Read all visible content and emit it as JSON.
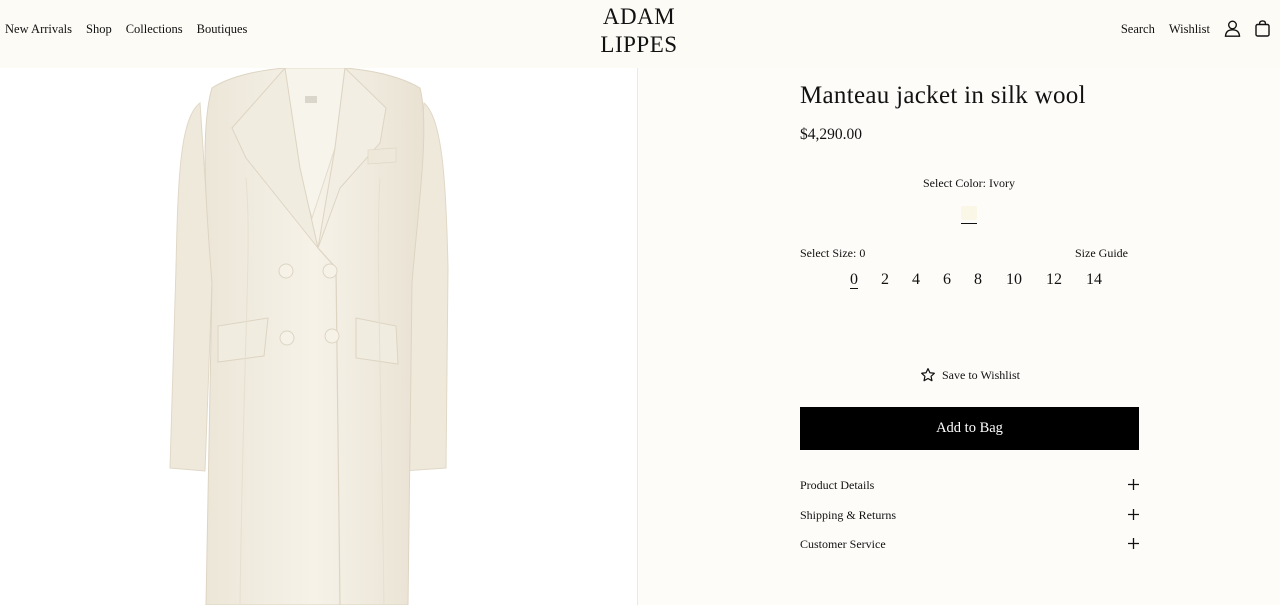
{
  "header": {
    "nav_left": [
      "New Arrivals",
      "Shop",
      "Collections",
      "Boutiques"
    ],
    "logo_line1": "ADAM",
    "logo_line2": "LIPPES",
    "search_label": "Search",
    "wishlist_label": "Wishlist",
    "icons": [
      "user-icon",
      "bag-icon"
    ]
  },
  "product": {
    "title": "Manteau jacket in silk wool",
    "price": "$4,290.00",
    "color_label": "Select Color: Ivory",
    "swatch_color": "#fbf7e6",
    "size_label": "Select Size: 0",
    "size_guide": "Size Guide",
    "sizes": [
      "0",
      "2",
      "4",
      "6",
      "8",
      "10",
      "12",
      "14"
    ],
    "selected_size": "0",
    "wishlist_label": "Save to Wishlist",
    "add_to_bag": "Add to Bag",
    "accordion": [
      "Product Details",
      "Shipping & Returns",
      "Customer Service"
    ]
  },
  "colors": {
    "background": "#fdfcf9",
    "button": "#000000",
    "coat": "#f4efe3"
  }
}
